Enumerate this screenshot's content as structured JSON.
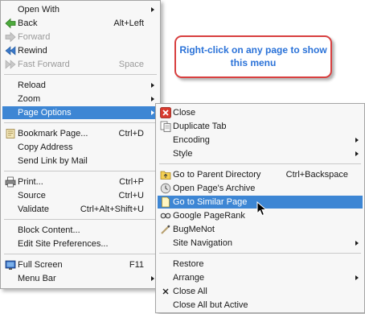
{
  "main_menu": {
    "items": [
      {
        "label": "Open With",
        "submenu": true,
        "icon": "none",
        "disabled": false
      },
      {
        "label": "Back",
        "shortcut": "Alt+Left",
        "icon": "back-arrow-icon",
        "disabled": false
      },
      {
        "label": "Forward",
        "icon": "forward-arrow-icon",
        "disabled": true
      },
      {
        "label": "Rewind",
        "icon": "rewind-icon",
        "disabled": false
      },
      {
        "label": "Fast Forward",
        "shortcut": "Space",
        "icon": "fast-forward-icon",
        "disabled": true
      },
      {
        "label": "Reload",
        "submenu": true,
        "icon": "none",
        "disabled": false
      },
      {
        "label": "Zoom",
        "submenu": true,
        "icon": "none",
        "disabled": false
      },
      {
        "label": "Page Options",
        "submenu": true,
        "icon": "none",
        "disabled": false,
        "highlighted": true
      },
      {
        "label": "Bookmark Page...",
        "shortcut": "Ctrl+D",
        "icon": "bookmark-icon",
        "disabled": false
      },
      {
        "label": "Copy Address",
        "icon": "none",
        "disabled": false
      },
      {
        "label": "Send Link by Mail",
        "icon": "none",
        "disabled": false
      },
      {
        "label": "Print...",
        "shortcut": "Ctrl+P",
        "icon": "printer-icon",
        "disabled": false
      },
      {
        "label": "Source",
        "shortcut": "Ctrl+U",
        "icon": "none",
        "disabled": false
      },
      {
        "label": "Validate",
        "shortcut": "Ctrl+Alt+Shift+U",
        "icon": "none",
        "disabled": false
      },
      {
        "label": "Block Content...",
        "icon": "none",
        "disabled": false
      },
      {
        "label": "Edit Site Preferences...",
        "icon": "none",
        "disabled": false
      },
      {
        "label": "Full Screen",
        "shortcut": "F11",
        "icon": "full-screen-icon",
        "disabled": false
      },
      {
        "label": "Menu Bar",
        "submenu": true,
        "icon": "none",
        "disabled": false
      }
    ]
  },
  "submenu": {
    "items": [
      {
        "label": "Close",
        "icon": "close-icon"
      },
      {
        "label": "Duplicate Tab",
        "icon": "duplicate-tab-icon"
      },
      {
        "label": "Encoding",
        "submenu": true,
        "icon": "none"
      },
      {
        "label": "Style",
        "submenu": true,
        "icon": "none"
      },
      {
        "label": "Go to Parent Directory",
        "shortcut": "Ctrl+Backspace",
        "icon": "parent-directory-icon"
      },
      {
        "label": "Open Page's Archive",
        "icon": "archive-icon"
      },
      {
        "label": "Go to Similar Page",
        "icon": "similar-page-icon",
        "highlighted": true
      },
      {
        "label": "Google PageRank",
        "icon": "pagerank-icon"
      },
      {
        "label": "BugMeNot",
        "icon": "bugmenot-icon"
      },
      {
        "label": "Site Navigation",
        "submenu": true,
        "icon": "none"
      },
      {
        "label": "Restore",
        "icon": "none"
      },
      {
        "label": "Arrange",
        "submenu": true,
        "icon": "none"
      },
      {
        "label": "Close All",
        "icon": "close-all-icon"
      },
      {
        "label": "Close All but Active",
        "icon": "none"
      }
    ]
  },
  "callout": {
    "text": "Right-click on any page to show this menu"
  },
  "colors": {
    "highlight": "#3d86d4",
    "callout_text": "#2a72d8",
    "callout_border": "#d84040"
  }
}
